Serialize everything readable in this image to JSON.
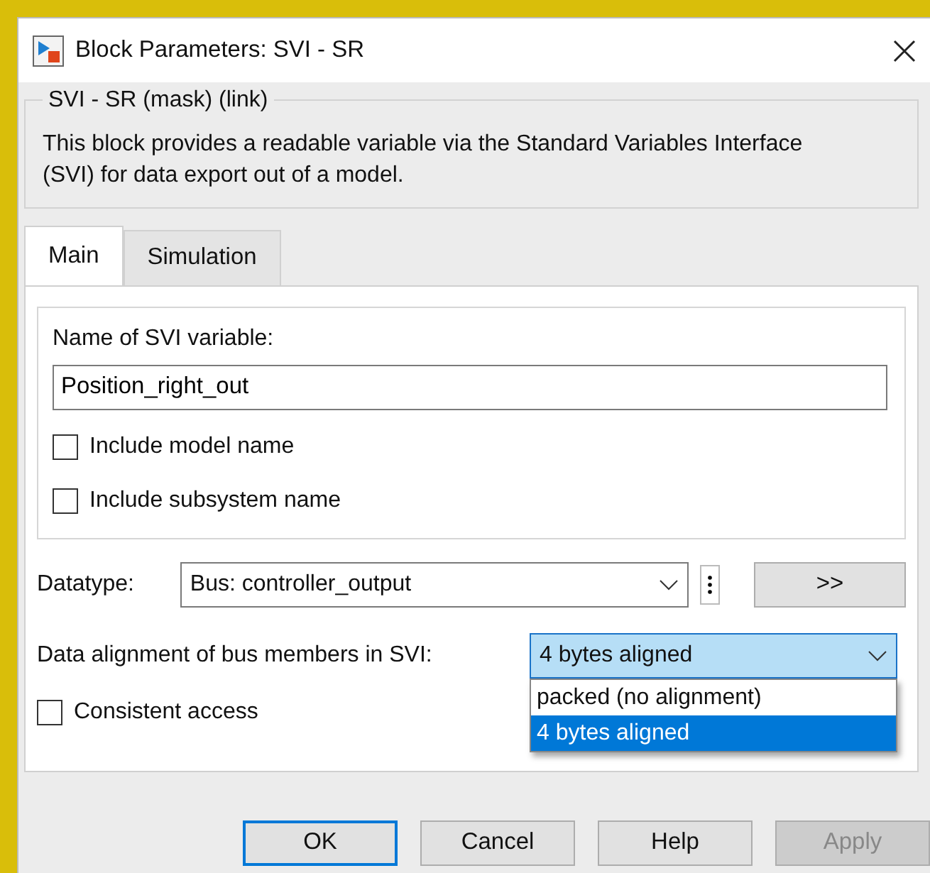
{
  "window": {
    "title": "Block Parameters: SVI - SR"
  },
  "description": {
    "title": "SVI - SR (mask) (link)",
    "text": "This block provides a readable variable via the Standard Variables Interface (SVI) for data export out of a model."
  },
  "tabs": [
    {
      "label": "Main",
      "selected": true
    },
    {
      "label": "Simulation",
      "selected": false
    }
  ],
  "name_field": {
    "label": "Name of SVI variable:",
    "value": "Position_right_out"
  },
  "options": [
    {
      "label": "Include model name",
      "checked": false
    },
    {
      "label": "Include subsystem name",
      "checked": false
    }
  ],
  "datatype": {
    "label": "Datatype:",
    "value": "Bus: controller_output",
    "button": ">>"
  },
  "alignment": {
    "label": "Data alignment of bus members in SVI:",
    "value": "4 bytes aligned",
    "expanded": true,
    "options": [
      {
        "label": "packed (no alignment)",
        "selected": false
      },
      {
        "label": "4 bytes aligned",
        "selected": true
      }
    ]
  },
  "consistent_access": {
    "label": "Consistent access",
    "checked": false
  },
  "buttons": [
    {
      "label": "OK",
      "kind": "default",
      "disabled": false
    },
    {
      "label": "Cancel",
      "kind": "normal",
      "disabled": false
    },
    {
      "label": "Help",
      "kind": "normal",
      "disabled": false
    },
    {
      "label": "Apply",
      "kind": "normal",
      "disabled": true
    }
  ]
}
